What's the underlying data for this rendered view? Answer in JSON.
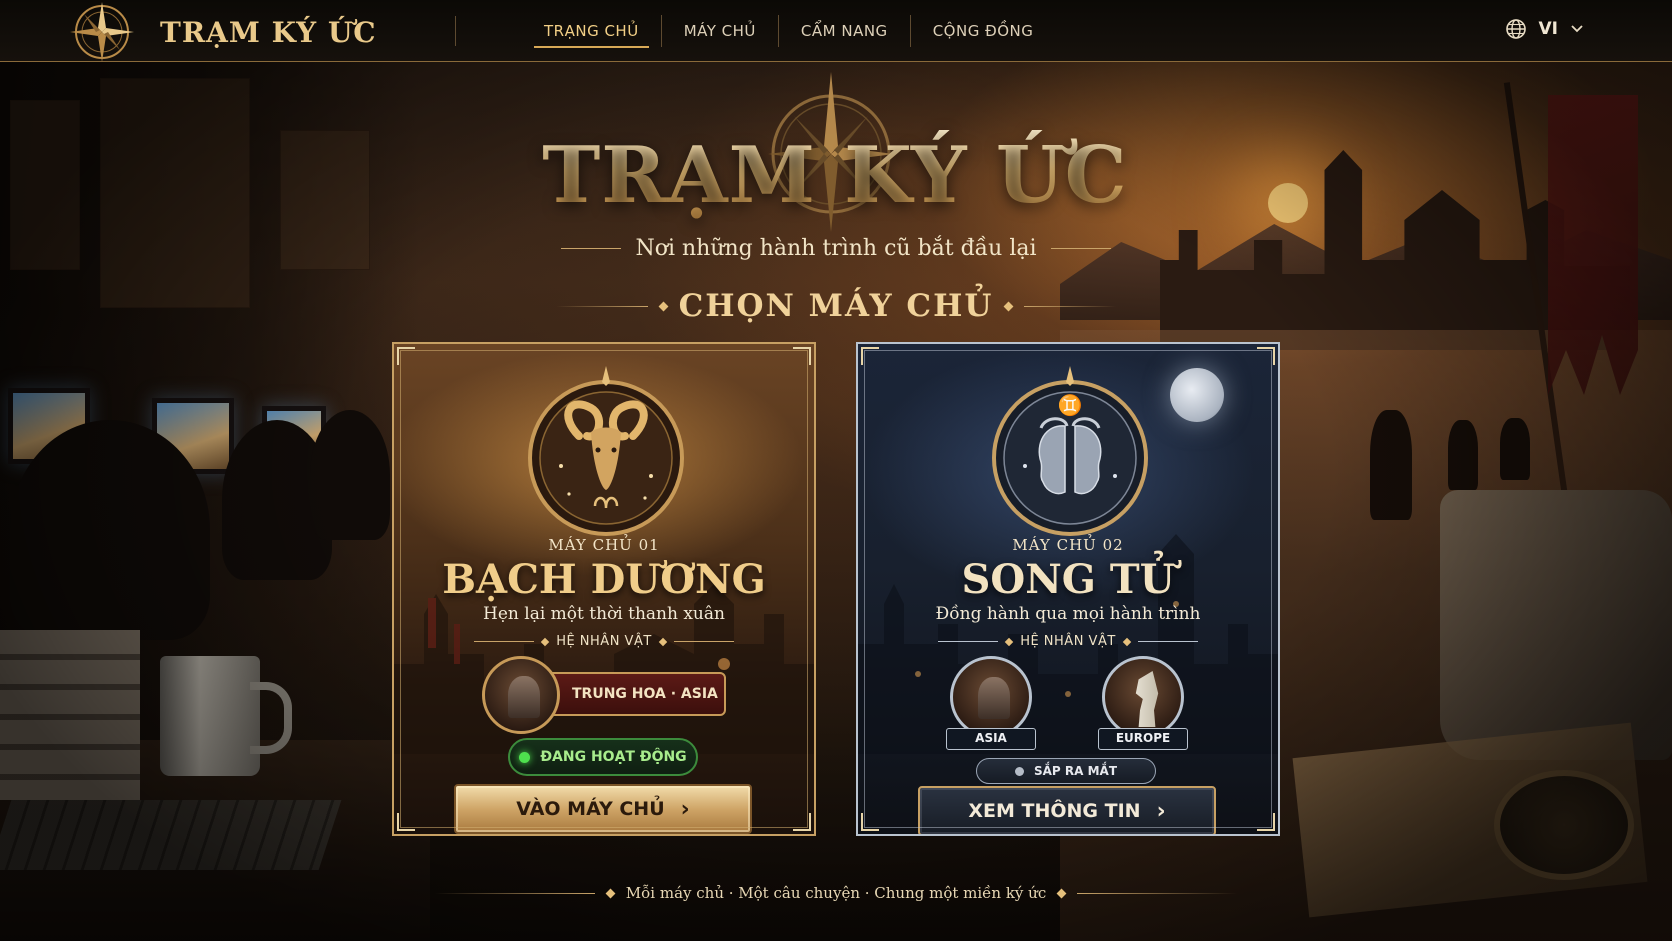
{
  "header": {
    "brand": "TRẠM KÝ ỨC",
    "nav": [
      "TRẠNG CHỦ",
      "MÁY CHỦ",
      "CẨM NANG",
      "CỘNG ĐỒNG"
    ],
    "active_index": 0,
    "language": "VI"
  },
  "hero": {
    "title": "TRẠM KÝ ỨC",
    "subtitle": "Nơi những hành trình cũ bắt đầu lại",
    "section_title": "CHỌN MÁY CHỦ"
  },
  "servers": [
    {
      "number": "MÁY CHỦ 01",
      "name": "BẠCH DƯƠNG",
      "tagline": "Hẹn lại một thời thanh xuân",
      "faction_label": "HỆ NHÂN VẬT",
      "factions": [
        "TRUNG HOA · ASIA"
      ],
      "status": "ĐANG HOẠT ĐỘNG",
      "cta": "VÀO MÁY CHỦ",
      "icon": "aries-ram-icon"
    },
    {
      "number": "MÁY CHỦ 02",
      "name": "SONG TỬ",
      "tagline": "Đồng hành qua mọi hành trình",
      "faction_label": "HỆ NHÂN VẬT",
      "factions": [
        "ASIA",
        "EUROPE"
      ],
      "status": "SẮP RA MẮT",
      "cta": "XEM THÔNG TIN",
      "icon": "gemini-twins-icon"
    }
  ],
  "footer": {
    "text": "Mỗi máy chủ · Một câu chuyện · Chung một miền ký ức"
  },
  "colors": {
    "gold": "#e6c07c",
    "active_green": "#4ee04e",
    "gemini_silver": "#b9c3cf",
    "banner_red": "#5c1a16"
  }
}
